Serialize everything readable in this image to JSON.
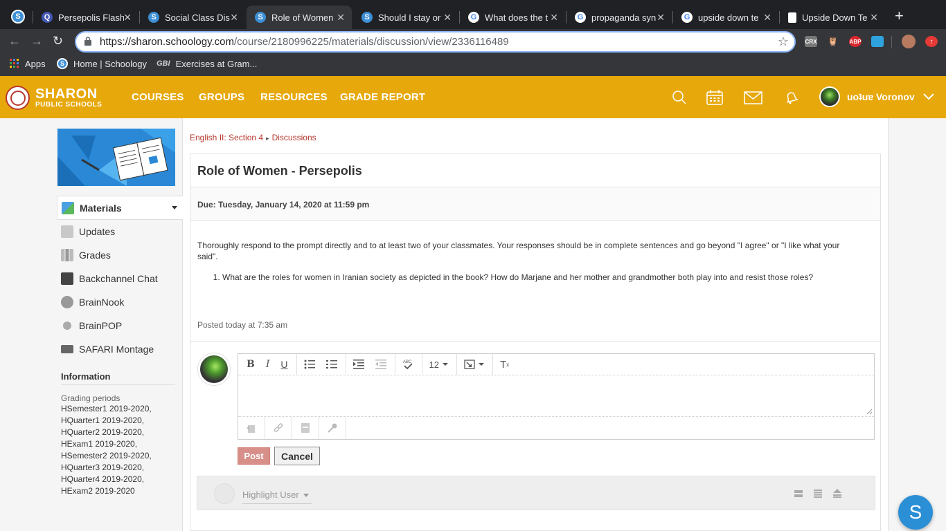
{
  "browser": {
    "tabs": [
      {
        "title": "Persepolis Flash",
        "favicon": "quizlet-icon"
      },
      {
        "title": "Social Class Dis",
        "favicon": "schoology-icon"
      },
      {
        "title": "Role of Women",
        "favicon": "schoology-icon",
        "active": true
      },
      {
        "title": "Should I stay or",
        "favicon": "schoology-icon"
      },
      {
        "title": "What does the t",
        "favicon": "google-icon"
      },
      {
        "title": "propaganda syn",
        "favicon": "google-icon"
      },
      {
        "title": "upside down te",
        "favicon": "google-icon"
      },
      {
        "title": "Upside Down Te",
        "favicon": "document-icon"
      }
    ],
    "url_host": "https://sharon.schoology.com",
    "url_path": "/course/2180996225/materials/discussion/view/2336116489",
    "extensions": [
      "CRX",
      "ABP"
    ],
    "bookmarks": [
      {
        "label": "Apps",
        "icon": "apps-grid-icon"
      },
      {
        "label": "Home | Schoology",
        "icon": "schoology-icon"
      },
      {
        "label": "Exercises at Gram...",
        "icon": "gbi-icon"
      }
    ]
  },
  "header": {
    "logo_line1": "SHARON",
    "logo_line2": "PUBLIC SCHOOLS",
    "nav": [
      "COURSES",
      "GROUPS",
      "RESOURCES",
      "GRADE REPORT"
    ],
    "user_name": "uoʇuɐ Voronov",
    "accent_color": "#e7a80b"
  },
  "sidebar": {
    "items": [
      {
        "label": "Materials",
        "icon": "materials-icon",
        "selected": true
      },
      {
        "label": "Updates",
        "icon": "updates-icon"
      },
      {
        "label": "Grades",
        "icon": "grades-icon"
      },
      {
        "label": "Backchannel Chat",
        "icon": "chat-icon"
      },
      {
        "label": "BrainNook",
        "icon": "brainnook-icon"
      },
      {
        "label": "BrainPOP",
        "icon": "brainpop-icon"
      },
      {
        "label": "SAFARI Montage",
        "icon": "safari-montage-icon"
      }
    ],
    "info_heading": "Information",
    "grading_label": "Grading periods",
    "grading_periods": [
      "HSemester1 2019-2020,",
      "HQuarter1 2019-2020,",
      "HQuarter2 2019-2020,",
      "HExam1 2019-2020,",
      "HSemester2 2019-2020,",
      "HQuarter3 2019-2020,",
      "HQuarter4 2019-2020,",
      "HExam2 2019-2020"
    ]
  },
  "breadcrumb": {
    "course": "English II: Section 4",
    "arrow": "▸",
    "section": "Discussions"
  },
  "discussion": {
    "title": "Role of Women - Persepolis",
    "due": "Due: Tuesday, January 14, 2020 at 11:59 pm",
    "prompt": "Thoroughly respond to the prompt directly and to at least two of your classmates. Your responses should be in complete sentences and go beyond \"I agree\" or \"I like what your said\".",
    "question": "What are the roles for women in Iranian society as depicted in the book?  How do Marjane and her mother and grandmother both play into and resist those roles?",
    "posted": "Posted today at 7:35 am"
  },
  "editor": {
    "font_size": "12",
    "post_label": "Post",
    "cancel_label": "Cancel"
  },
  "replies": {
    "highlight_label": "Highlight User"
  },
  "fab_label": "S"
}
